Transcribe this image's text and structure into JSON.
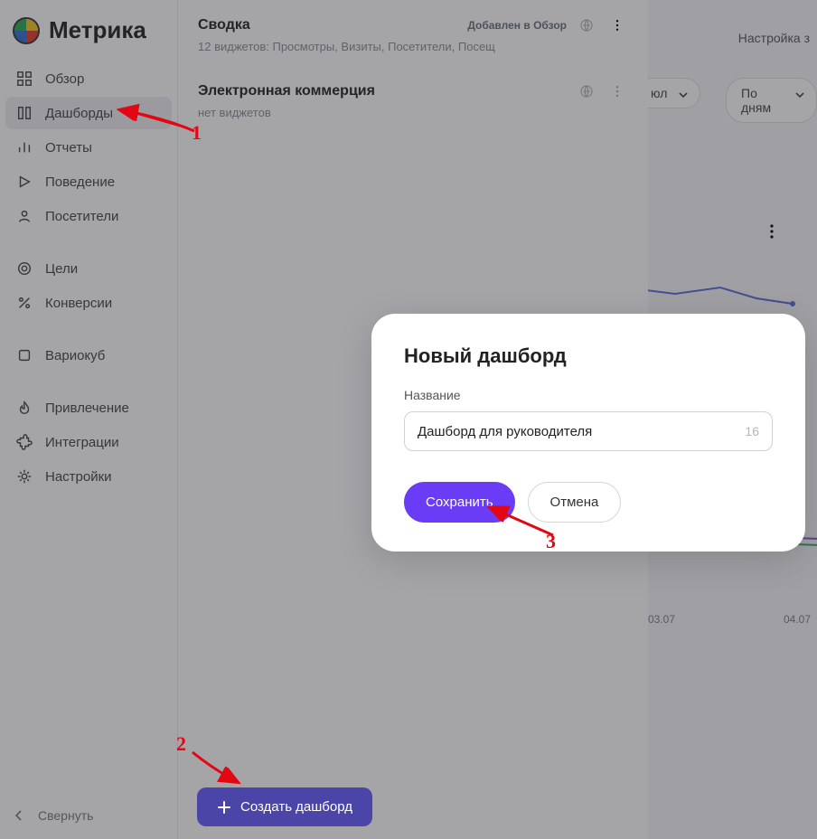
{
  "logo": {
    "text": "Метрика"
  },
  "sidebar": {
    "items": [
      {
        "label": "Обзор"
      },
      {
        "label": "Дашборды"
      },
      {
        "label": "Отчеты"
      },
      {
        "label": "Поведение"
      },
      {
        "label": "Посетители"
      },
      {
        "label": "Цели"
      },
      {
        "label": "Конверсии"
      },
      {
        "label": "Вариокуб"
      },
      {
        "label": "Привлечение"
      },
      {
        "label": "Интеграции"
      },
      {
        "label": "Настройки"
      }
    ],
    "active_index": 1,
    "collapse_label": "Свернуть"
  },
  "dashboards": [
    {
      "title": "Сводка",
      "subtitle": "12 виджетов: Просмотры, Визиты, Посетители, Посещ",
      "badge": "Добавлен в Обзор"
    },
    {
      "title": "Электронная коммерция",
      "subtitle": "нет виджетов",
      "badge": ""
    }
  ],
  "create_button_label": "Создать дашборд",
  "bg": {
    "settings_text": "Настройка з",
    "pill1": "юл",
    "pill2": "По дням",
    "axis1": "03.07",
    "axis2": "04.07"
  },
  "modal": {
    "title": "Новый дашборд",
    "label": "Название",
    "value": "Дашборд для руководителя",
    "char_count": "16",
    "save": "Сохранить",
    "cancel": "Отмена"
  },
  "annotations": {
    "n1": "1",
    "n2": "2",
    "n3": "3"
  }
}
